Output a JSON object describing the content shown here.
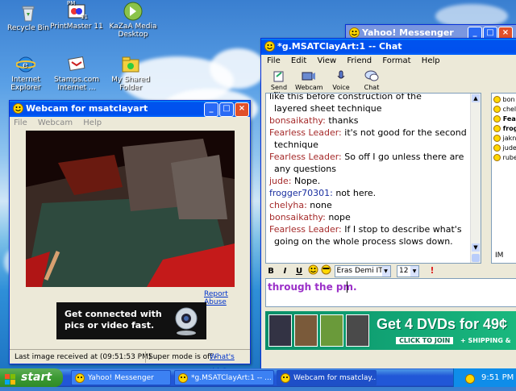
{
  "desktop": {
    "icons": [
      {
        "label": "Recycle Bin"
      },
      {
        "label": "PrintMaster 11"
      },
      {
        "label": "KaZaA Media Desktop"
      },
      {
        "label": "Internet Explorer"
      },
      {
        "label": "Stamps.com Internet ..."
      },
      {
        "label": "My Shared Folder"
      }
    ],
    "partial_left": [
      "Ex",
      "In",
      "O",
      "N",
      "Ar"
    ],
    "printmaster_badge": "PM",
    "printmaster_sub": "11"
  },
  "webcam": {
    "title": "Webcam for msatclayart",
    "menu": [
      "File",
      "Webcam",
      "Help"
    ],
    "report_abuse": "Report Abuse",
    "ad_text_1": "Get connected with",
    "ad_text_2": "pics or video fast.",
    "status_left": "Last image received at (09:51:53 PM)",
    "status_right_prefix": "Super mode is off - ",
    "status_right_link": "What's this?"
  },
  "yahoo_back": {
    "title": "Yahoo! Messenger"
  },
  "chat": {
    "title": "*g.MSATClayArt:1 -- Chat",
    "menu": [
      "File",
      "Edit",
      "View",
      "Friend",
      "Format",
      "Help"
    ],
    "toolbar": [
      "Send File",
      "Webcam",
      "Voice",
      "Chat"
    ],
    "messages": [
      {
        "nick": "",
        "text": "like this before construction of the",
        "color": "red"
      },
      {
        "nick": "",
        "text": "layered sheet technique",
        "color": "red",
        "indent": true
      },
      {
        "nick": "bonsaikathy:",
        "text": " thanks",
        "color": "red"
      },
      {
        "nick": "Fearless Leader:",
        "text": " it's not good for the second",
        "color": "red"
      },
      {
        "nick": "",
        "text": "technique",
        "color": "red",
        "indent": true
      },
      {
        "nick": "Fearless Leader:",
        "text": " So off I go unless there are",
        "color": "red"
      },
      {
        "nick": "",
        "text": "any questions",
        "color": "red",
        "indent": true
      },
      {
        "nick": "jude:",
        "text": " Nope.",
        "color": "red"
      },
      {
        "nick": "frogger70301:",
        "text": " not here.",
        "color": "blue"
      },
      {
        "nick": "chelyha:",
        "text": " none",
        "color": "red"
      },
      {
        "nick": "bonsaikathy:",
        "text": " nope",
        "color": "red"
      },
      {
        "nick": "Fearless Leader:",
        "text": " If I stop to describe what's",
        "color": "red"
      },
      {
        "nick": "",
        "text": "going on the whole process slows down.",
        "color": "red",
        "indent": true
      }
    ],
    "users": [
      "bon",
      "chel",
      "Fea",
      "frog",
      "jakn",
      "jude",
      "rube"
    ],
    "im_label": "IM",
    "format": {
      "bold": "B",
      "italic": "I",
      "underline": "U",
      "font": "Eras Demi ITC",
      "size": "12"
    },
    "input_text": "through the pm.",
    "banner_text": "Get 4 DVDs for 49¢",
    "banner_click": "CLICK TO JOIN",
    "banner_shipping": "+ SHIPPING &"
  },
  "taskbar": {
    "start": "start",
    "items": [
      "Yahoo! Messenger",
      "*g.MSATClayArt:1 -- ...",
      "Webcam for msatclay..."
    ],
    "clock": "9:51 PM"
  },
  "colors": {
    "xp_blue": "#0053ee",
    "nick_red": "#a52a2a",
    "nick_blue": "#1a2fa0",
    "input_purple": "#9b30c8"
  }
}
